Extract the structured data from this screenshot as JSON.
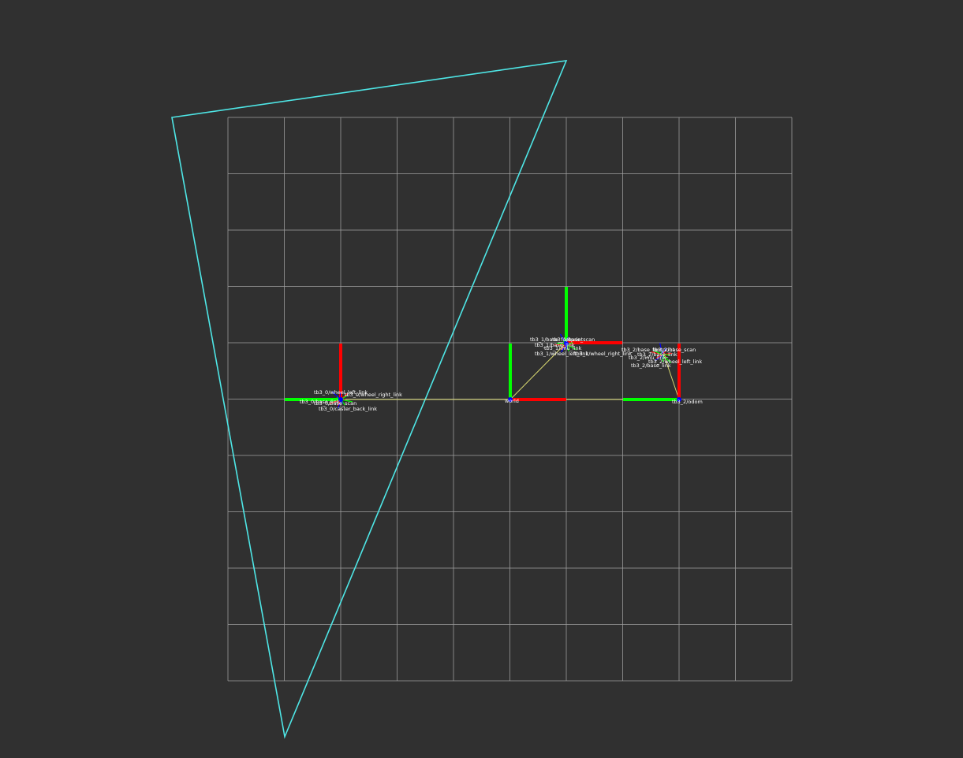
{
  "scene": {
    "background": "#303030",
    "grid_color": "#a0a0a0",
    "grid_cells": 10,
    "camera_frustum_color": "#4ee6e6",
    "link_line_color": "#d8d870",
    "axis_colors": {
      "x": "#ff0000",
      "y": "#00ff00",
      "z": "#0000ff"
    },
    "label_color": "#ffffff"
  },
  "frames": [
    {
      "id": "frame-left-cluster",
      "name": "tb3_0/base_link",
      "labels": [
        "tb3_0/wheel_right_link",
        "tb3_0/base_scan",
        "tb3_0/base_footprint",
        "tb3_0/caster_back_link",
        "tb3_0/wheel_left_link"
      ]
    },
    {
      "id": "frame-world",
      "name": "world",
      "labels": [
        "world"
      ]
    },
    {
      "id": "frame-top-cluster",
      "name": "tb3_1/base_link",
      "labels": [
        "tb3_1/base_footprint",
        "tb3_1/base_scan",
        "tb3_1/imu_link",
        "tb3_1/wheel_left_link",
        "tb3_1/wheel_right_link"
      ]
    },
    {
      "id": "frame-right-cluster",
      "name": "tb3_2/base_link",
      "labels": [
        "tb3_2/base_footprint",
        "tb3_2/base_scan",
        "tb3_2/imu_link",
        "tb3_2/wheel_left_link",
        "tb3_2/odom"
      ]
    }
  ]
}
